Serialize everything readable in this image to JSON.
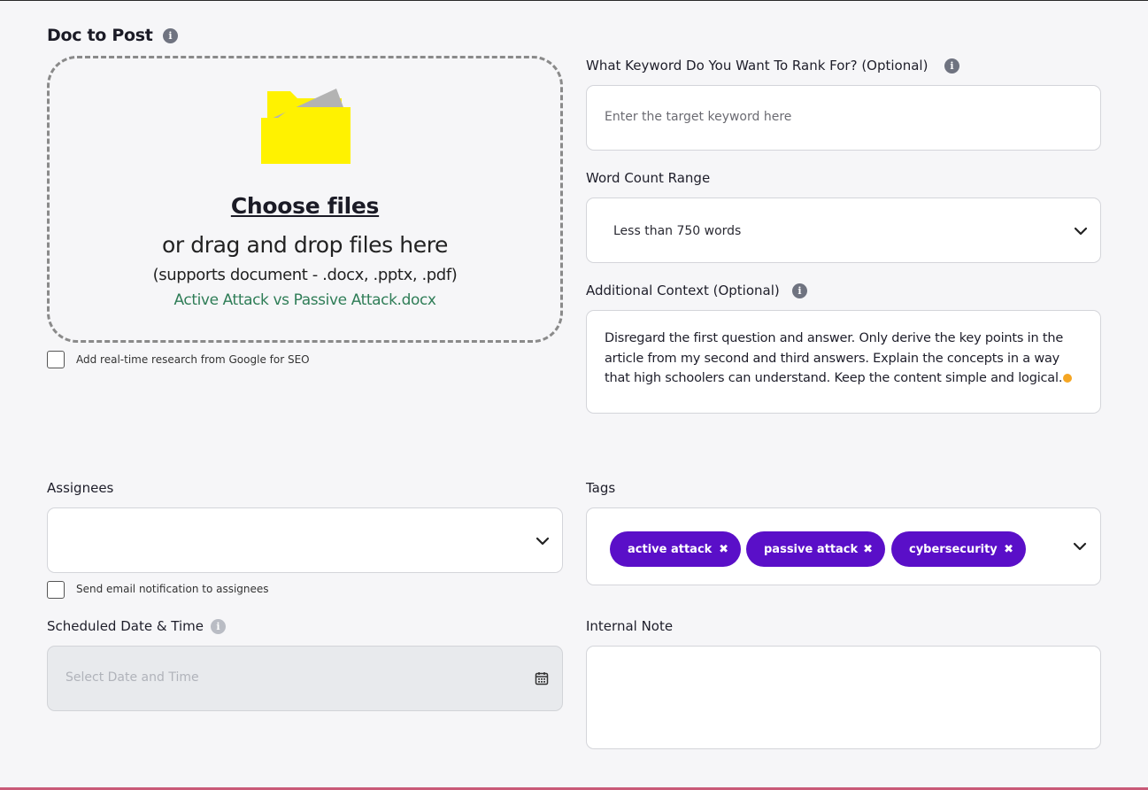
{
  "page_title": "Doc to Post",
  "upload": {
    "choose_label": "Choose files",
    "drag_text": "or drag and drop files here",
    "supports_text": "(supports document - .docx, .pptx, .pdf)",
    "file_name": "Active Attack vs Passive Attack.docx",
    "icon": "folder-icon"
  },
  "research_checkbox": {
    "label": "Add real-time research from Google for SEO",
    "checked": false
  },
  "keyword": {
    "label": "What Keyword Do You Want To Rank For? (Optional)",
    "placeholder": "Enter the target keyword here",
    "value": ""
  },
  "word_count": {
    "label": "Word Count Range",
    "selected": "Less than 750 words"
  },
  "context": {
    "label": "Additional Context (Optional)",
    "value": "Disregard the first question and answer. Only derive the key points in the article from my second and third answers. Explain the concepts in a way that high schoolers can understand. Keep the content simple and logical."
  },
  "assignees": {
    "label": "Assignees",
    "selected": ""
  },
  "notify_checkbox": {
    "label": "Send email notification to assignees",
    "checked": false
  },
  "tags": {
    "label": "Tags",
    "items": [
      {
        "label": "active attack"
      },
      {
        "label": "passive attack"
      },
      {
        "label": "cybersecurity"
      }
    ],
    "color": "#5a0fc8"
  },
  "schedule": {
    "label": "Scheduled Date & Time",
    "placeholder": "Select Date and Time"
  },
  "internal_note": {
    "label": "Internal Note",
    "value": ""
  },
  "colors": {
    "accent": "#5a0fc8",
    "file_name": "#2f7d57",
    "folder": "#fff200"
  }
}
